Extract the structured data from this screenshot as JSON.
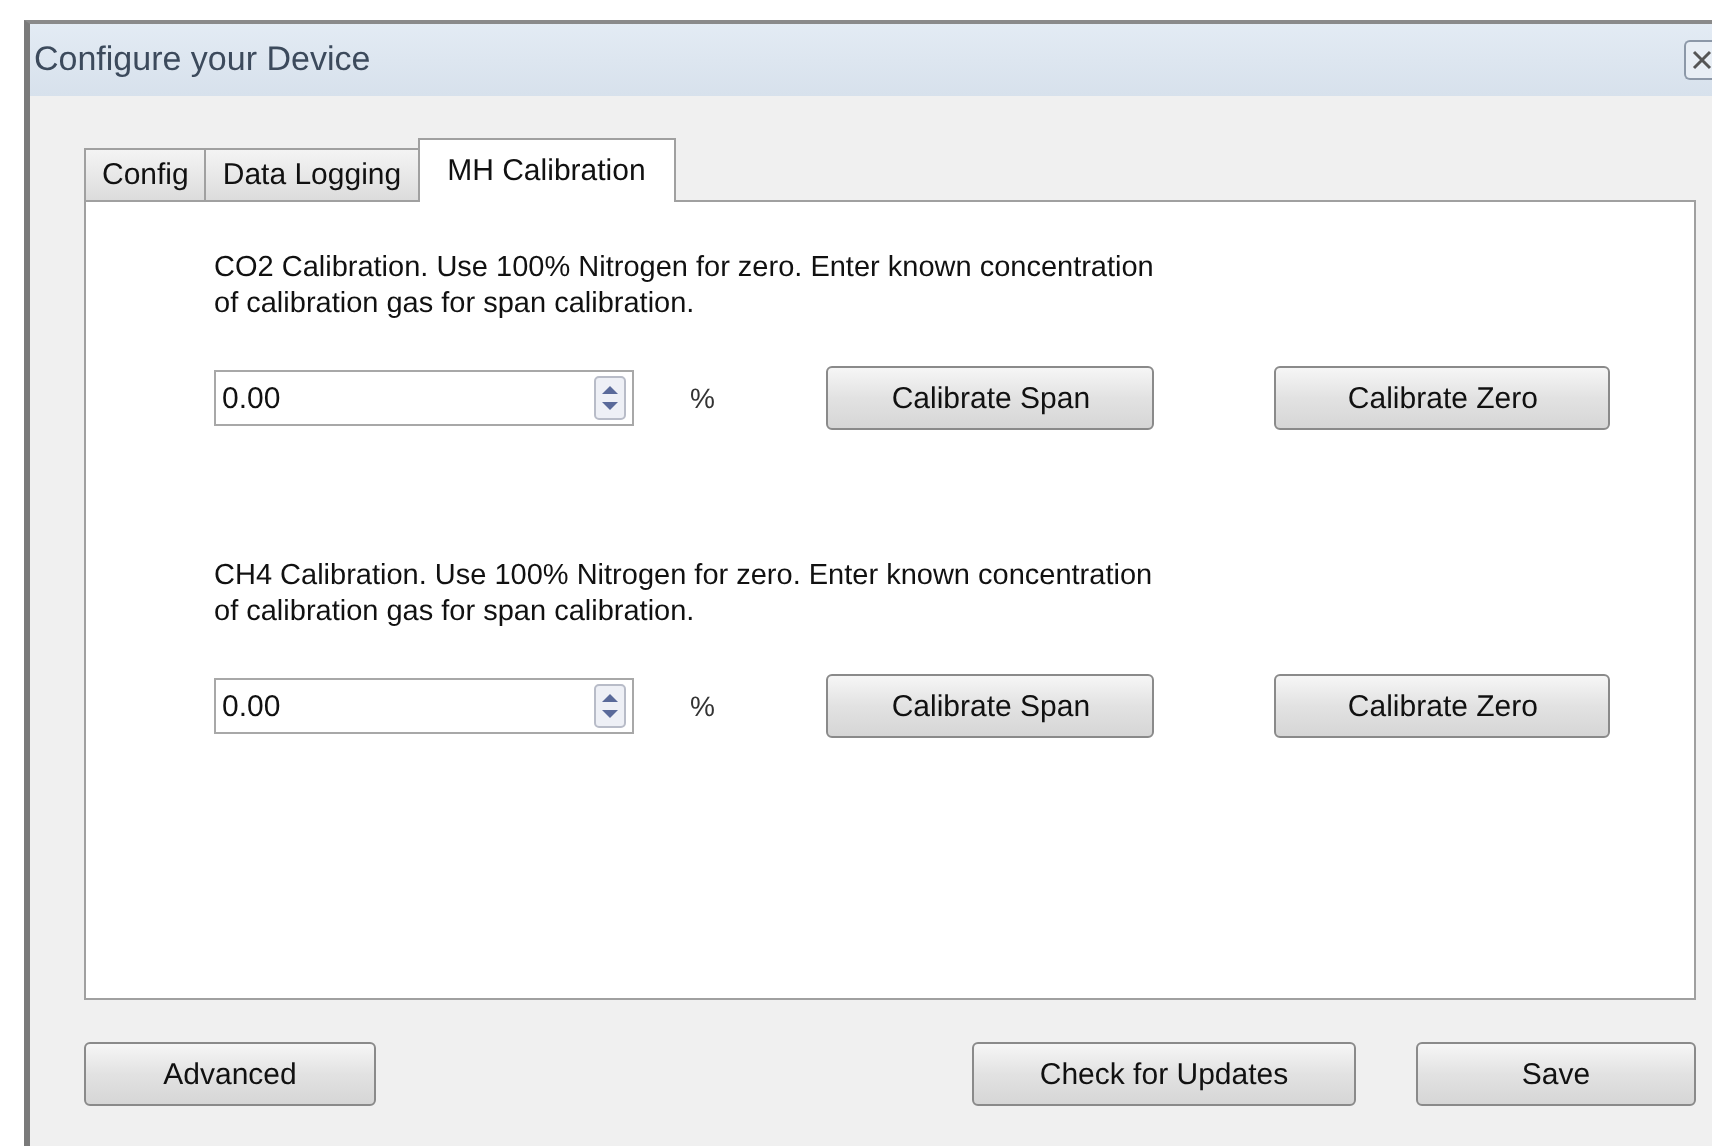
{
  "window": {
    "title": "Configure your Device"
  },
  "tabs": [
    {
      "label": "Config",
      "selected": false
    },
    {
      "label": "Data Logging",
      "selected": false
    },
    {
      "label": "MH Calibration",
      "selected": true
    }
  ],
  "sections": [
    {
      "description": "CO2 Calibration. Use 100% Nitrogen for zero. Enter known concentration\nof calibration gas for span calibration.",
      "value": "0.00",
      "unit": "%",
      "buttons": [
        "Calibrate Span",
        "Calibrate Zero"
      ]
    },
    {
      "description": "CH4 Calibration. Use 100% Nitrogen for zero. Enter known concentration\nof calibration gas for span calibration.",
      "value": "0.00",
      "unit": "%",
      "buttons": [
        "Calibrate Span",
        "Calibrate Zero"
      ]
    }
  ],
  "footer": {
    "left": "Advanced",
    "middle": "Check for Updates",
    "right": "Save"
  }
}
